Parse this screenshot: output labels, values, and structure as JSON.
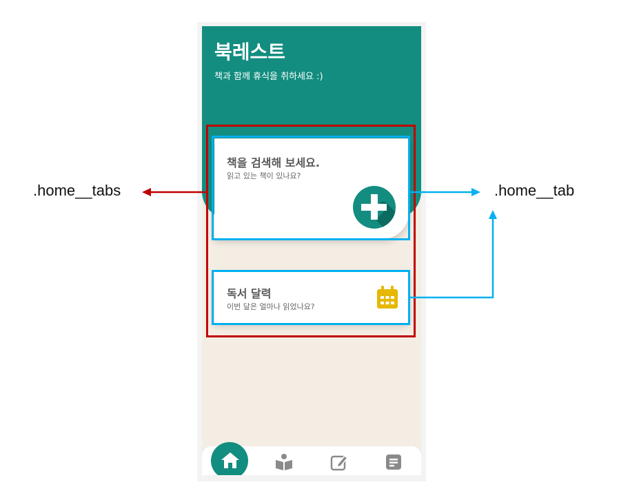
{
  "app": {
    "title": "북레스트",
    "subtitle": "책과 함께 휴식을 취하세요 :)"
  },
  "tabs": [
    {
      "title": "책을 검색해 보세요.",
      "description": "읽고 있는 책이 있나요?",
      "icon": "plus-circle-icon"
    },
    {
      "title": "독서 달력",
      "description": "이번 달은 얼마나 읽었나요?",
      "icon": "calendar-icon"
    }
  ],
  "navbar": {
    "items": [
      "home-icon",
      "reading-icon",
      "edit-icon",
      "notes-icon"
    ],
    "active": "home-icon"
  },
  "annotations": {
    "tabs_label": ".home__tabs",
    "tab_label": ".home__tab"
  },
  "colors": {
    "primary": "#138d80",
    "background": "#f4ede4",
    "calendar_icon": "#e6b800",
    "nav_icon": "#8a8a8a",
    "annotation_red": "#c00000",
    "annotation_blue": "#00b0f0"
  }
}
